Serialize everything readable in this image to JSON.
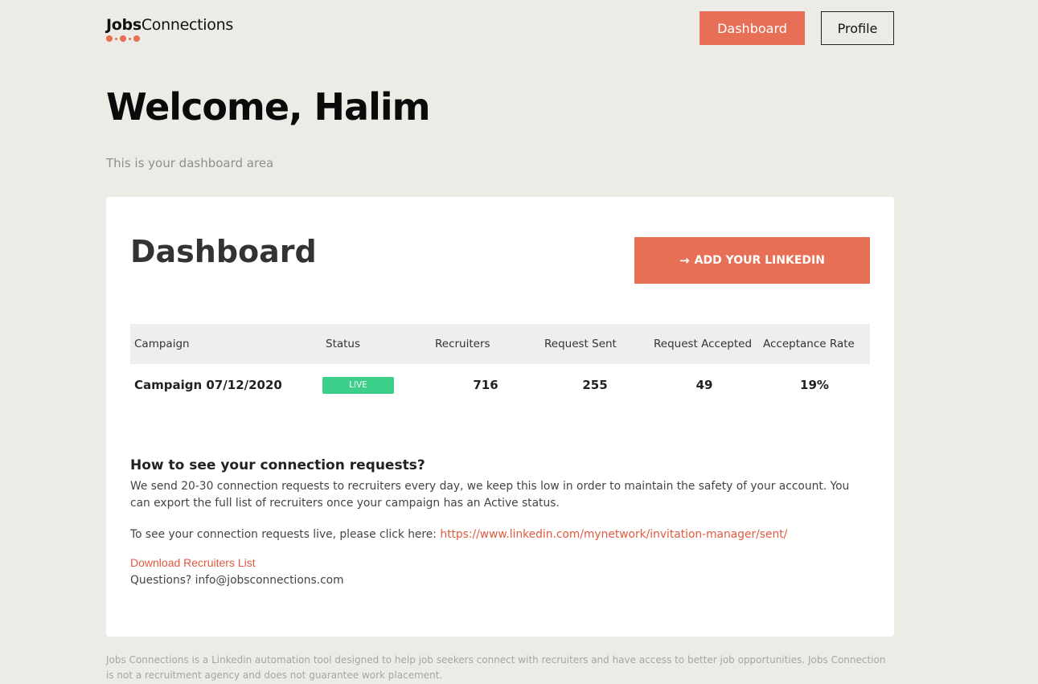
{
  "header": {
    "logo_bold": "Jobs",
    "logo_light": "Connections",
    "nav": {
      "dashboard": "Dashboard",
      "profile": "Profile"
    }
  },
  "welcome": {
    "title": "Welcome, Halim",
    "subtitle": "This is your dashboard area"
  },
  "card": {
    "title": "Dashboard",
    "add_linkedin_icon": "arrow-right-icon",
    "add_linkedin_arrow": "→",
    "add_linkedin_label": "ADD YOUR LINKEDIN",
    "table": {
      "headers": [
        "Campaign",
        "Status",
        "Recruiters",
        "Request Sent",
        "Request Accepted",
        "Acceptance Rate"
      ],
      "rows": [
        {
          "campaign": "Campaign 07/12/2020",
          "status": "LIVE",
          "recruiters": "716",
          "sent": "255",
          "accepted": "49",
          "rate": "19%"
        }
      ]
    },
    "info": {
      "heading": "How to see your connection requests?",
      "body": "We send 20-30 connection requests to recruiters every day, we keep this low in order to maintain the safety of your account. You can export the full list of recruiters once your campaign has an Active status.",
      "live_prefix": "To see your connection requests live, please click here: ",
      "live_url": "https://www.linkedin.com/mynetwork/invitation-manager/sent/",
      "download_label": "Download Recruiters List",
      "questions": "Questions? info@jobsconnections.com"
    }
  },
  "footer": {
    "text": "Jobs Connections is a Linkedin automation tool designed to help job seekers connect with recruiters and have access to better job opportunities. Jobs Connection is not a recruitment agency and does not guarantee work placement."
  },
  "colors": {
    "accent": "#e76f55",
    "live": "#3ccf8a",
    "background": "#ecebe6",
    "link": "#e05a3f"
  }
}
